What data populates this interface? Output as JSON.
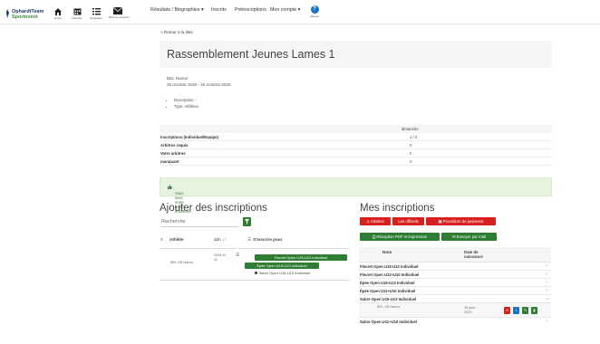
{
  "nav": {
    "logo_line1": "OphardtTeam",
    "logo_line2": "Sportevent",
    "icons": [
      {
        "name": "home-icon",
        "label": "Home"
      },
      {
        "name": "calendar-icon",
        "label": "Kalender"
      },
      {
        "name": "list-icon",
        "label": "Ranglisten"
      },
      {
        "name": "mail-icon",
        "label": "Boîte de réception"
      }
    ],
    "menu": [
      "Résultats / Biographies ▾",
      "Inscrits",
      "Préinscriptions",
      "Mon compte ▾"
    ],
    "help_label": "Manuel",
    "help_symbol": "?"
  },
  "page": {
    "back_link": "< Retour à la liste",
    "title": "Rassemblement Jeunes Lames 1",
    "club": "BEL Namur",
    "dates": "25 octobre 2020 - 25 octobre 2020",
    "bullets": [
      "Description: -",
      "Type: Athlètes"
    ]
  },
  "stats": {
    "column_header": "dimanche",
    "rows": [
      {
        "label": "Inscriptions (Individuel/Équipe)",
        "value": "1 / 0"
      },
      {
        "label": "Arbitres requis",
        "value": "0"
      },
      {
        "label": "Votre arbitres",
        "value": "0"
      },
      {
        "label": "manquant",
        "value": "0"
      }
    ]
  },
  "alert": "Vous avez entré assez d'arbitres.",
  "add": {
    "heading": "Ajouter des inscriptions",
    "search_placeholder": "Recherche",
    "col_sort": "≡",
    "col_athlete": "Athlète",
    "col_dob": "ddn ↓↑",
    "col_register": "S'inscrire pour",
    "athlete_name": "BEL VB Namur",
    "athlete_dob": "2004 M 11",
    "buttons": [
      "Fleuret Open U15-U13 Individuel",
      "Épée Open U15-U13 Individuel"
    ],
    "radio_text": "Sabre Open U15-U13 Individuel"
  },
  "mine": {
    "heading": "Mes inscriptions",
    "buttons_row1": [
      "Arbitres",
      "Les officiels",
      "Procédure de paiement"
    ],
    "buttons_row2": [
      "Réception PDF et impression",
      "Envoyer par mail"
    ],
    "col_name": "Nom",
    "col_date": "Date de naissance",
    "rows": [
      "Fleuret Open U15-U13 Individuel",
      "Fleuret Open U11+U10 Individuel",
      "Épée Open U15-U13 Individuel",
      "Épée Open U11+U10 Individuel",
      "Sabre Open U15-U13 Individuel"
    ],
    "sub_name": "BEL VB Namur",
    "sub_date": "15 janv. 2005",
    "last_row": "Sabre Open U11+U10 Individuel",
    "chevron": "›"
  },
  "colors": {
    "primary_green": "#2e7d32",
    "danger_red": "#d9201e",
    "help_blue": "#1a73c9",
    "logo_navy": "#1d3b62",
    "logo_green": "#3a8a3a",
    "alert_bg": "#e7f2df"
  }
}
